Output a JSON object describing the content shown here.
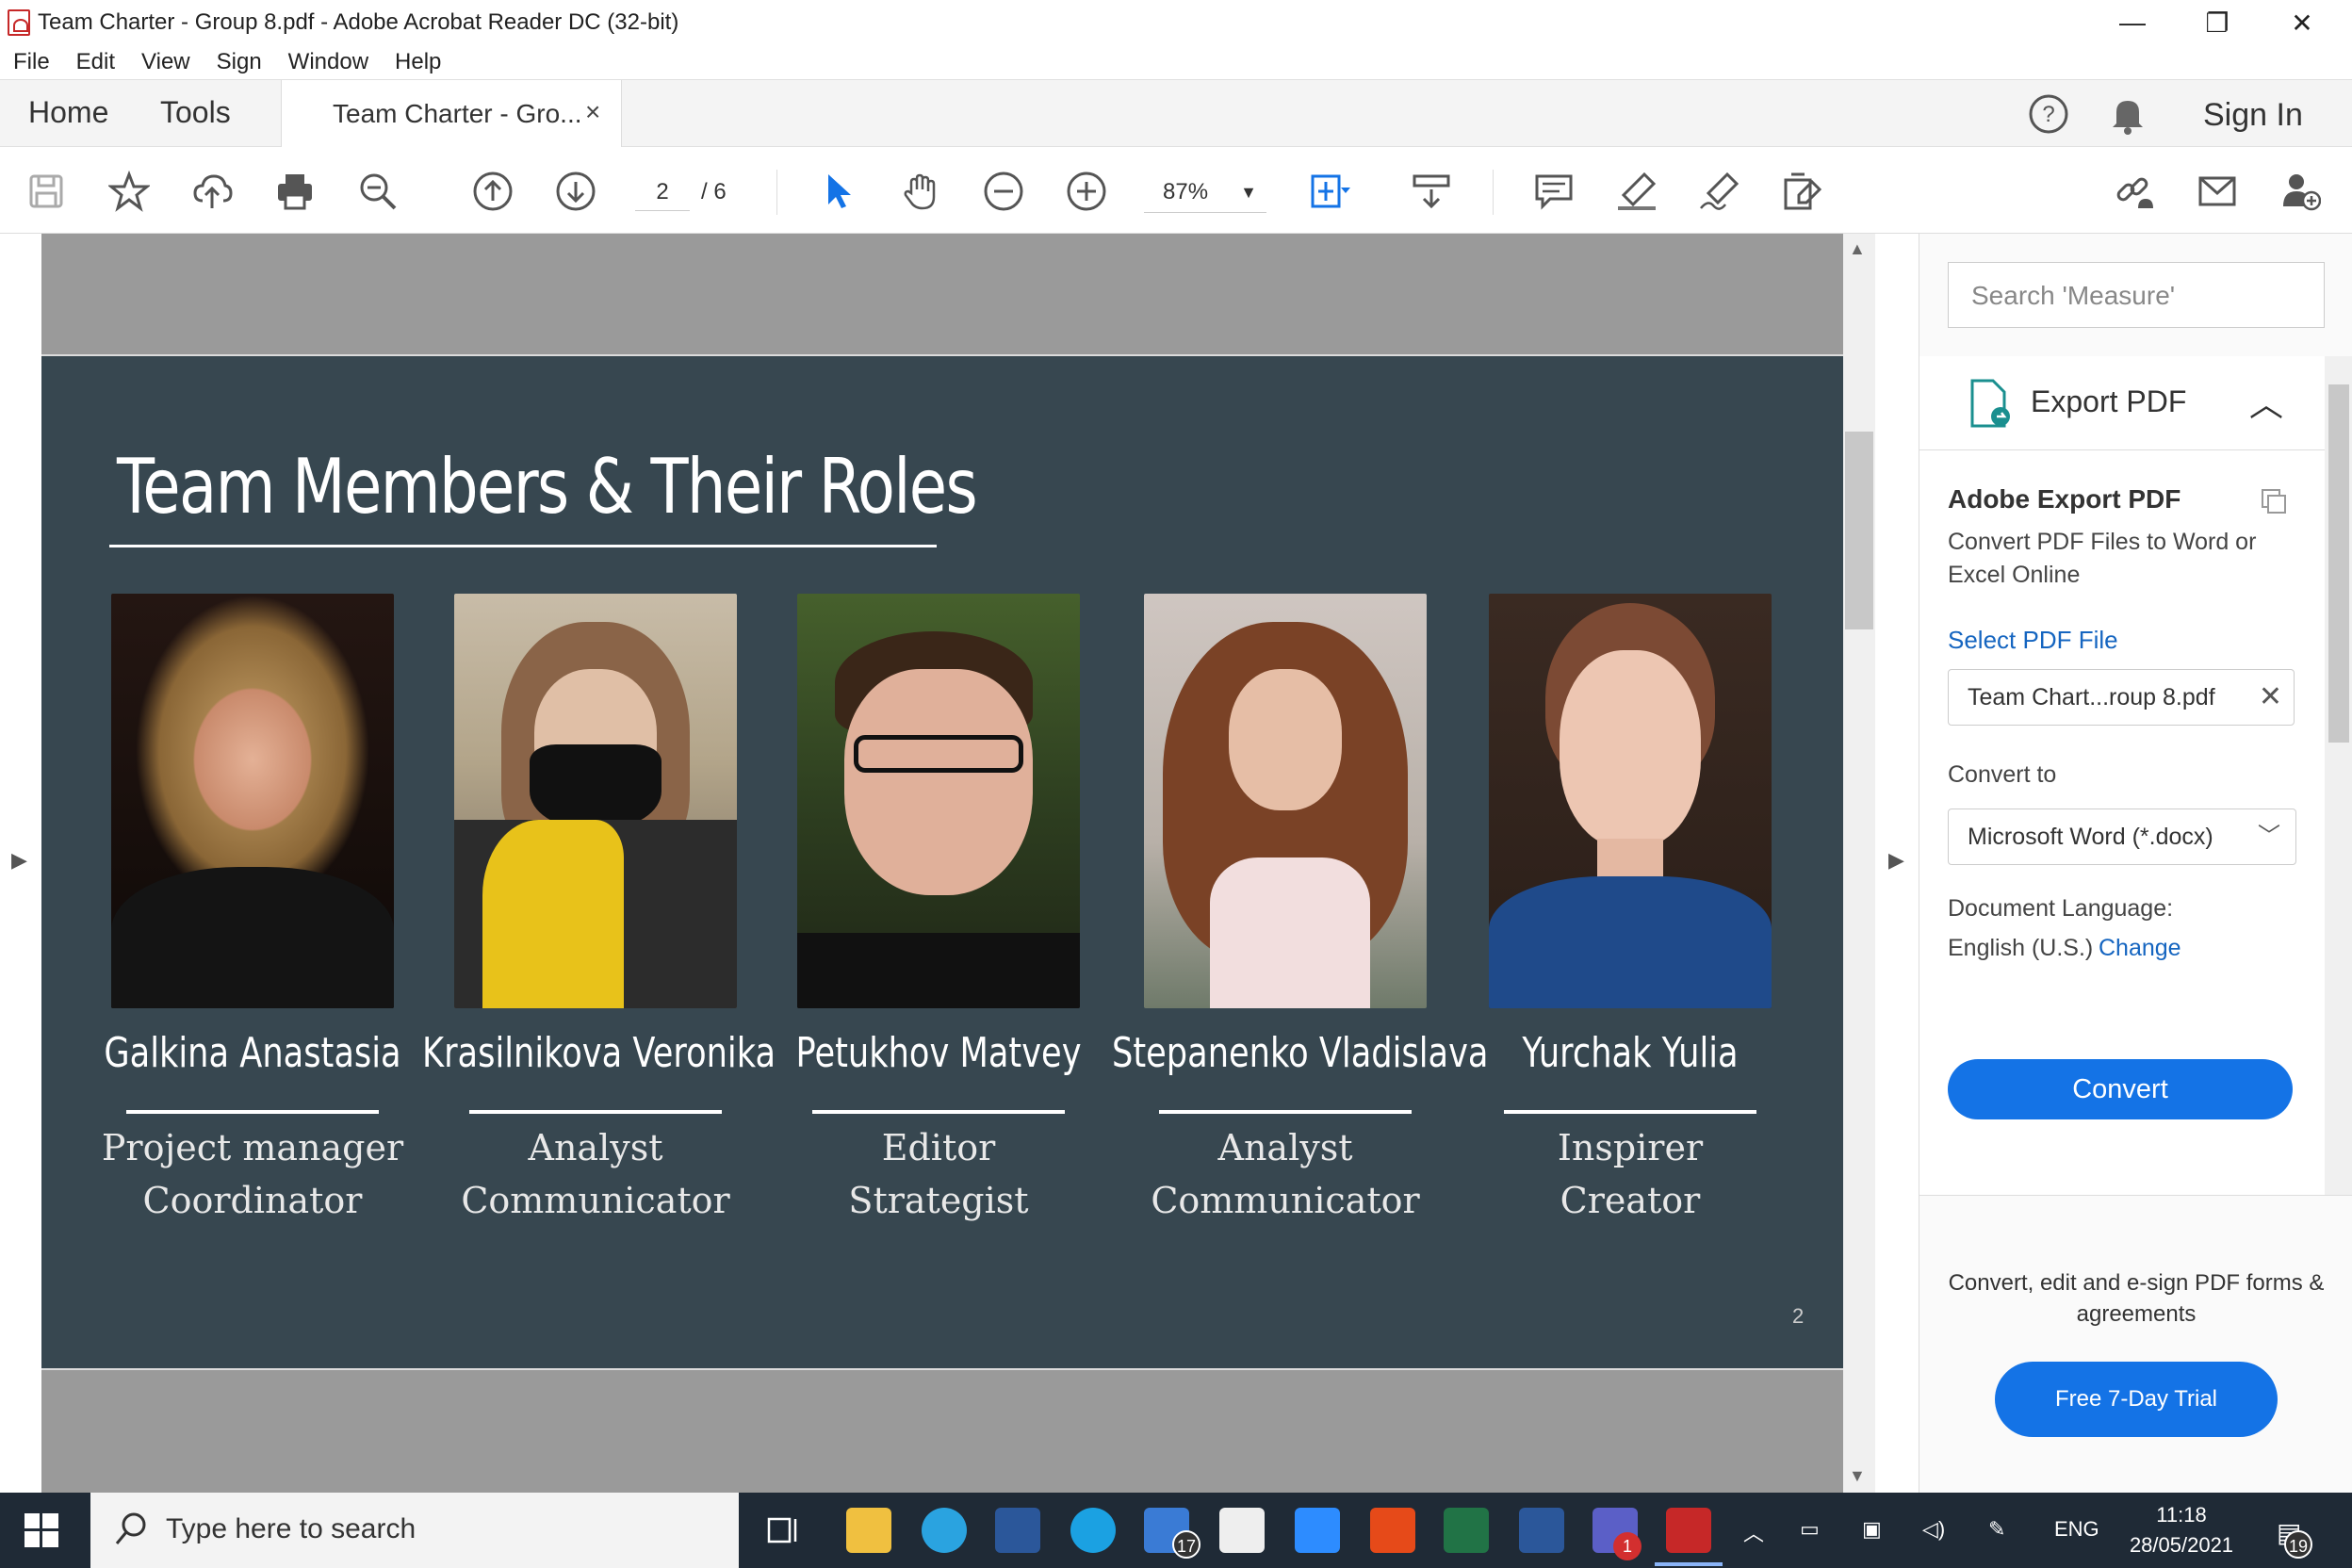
{
  "window": {
    "title": "Team Charter - Group 8.pdf - Adobe Acrobat Reader DC (32-bit)",
    "minimize": "—",
    "restore": "❐",
    "close": "✕"
  },
  "menu": [
    "File",
    "Edit",
    "View",
    "Sign",
    "Window",
    "Help"
  ],
  "tabs": {
    "home": "Home",
    "tools": "Tools",
    "doc_tab": "Team Charter - Gro...",
    "doc_tab_close": "×",
    "sign_in": "Sign In"
  },
  "toolbar": {
    "page_current": "2",
    "page_total": "/ 6",
    "zoom": "87%"
  },
  "slide": {
    "heading": "Team Members & Their Roles",
    "page_number": "2",
    "members": [
      {
        "name": "Galkina Anastasia",
        "role1": "Project manager",
        "role2": "Coordinator"
      },
      {
        "name": "Krasilnikova Veronika",
        "role1": "Analyst",
        "role2": "Communicator"
      },
      {
        "name": "Petukhov Matvey",
        "role1": "Editor",
        "role2": "Strategist"
      },
      {
        "name": "Stepanenko Vladislava",
        "role1": "Analyst",
        "role2": "Communicator"
      },
      {
        "name": "Yurchak Yulia",
        "role1": "Inspirer",
        "role2": "Creator"
      }
    ]
  },
  "panel": {
    "search_placeholder": "Search 'Measure'",
    "section_title": "Export PDF",
    "heading": "Adobe Export PDF",
    "description": "Convert PDF Files to Word or Excel Online",
    "select_file_link": "Select PDF File",
    "file_name": "Team Chart...roup 8.pdf",
    "convert_to_label": "Convert to",
    "convert_to_value": "Microsoft Word (*.docx)",
    "doc_lang_label": "Document Language:",
    "doc_lang_value": "English (U.S.)",
    "change_link": "Change",
    "convert_button": "Convert",
    "promo_text": "Convert, edit and e-sign PDF forms & agreements",
    "trial_button": "Free 7-Day Trial"
  },
  "taskbar": {
    "search_placeholder": "Type here to search",
    "mail_badge": "17",
    "teams_badge": "1",
    "lang": "ENG",
    "time": "11:18",
    "date": "28/05/2021",
    "notif_badge": "19"
  },
  "colors": {
    "slide_bg": "#374750",
    "accent_blue": "#1473e6",
    "taskbar": "#1f2a36"
  }
}
